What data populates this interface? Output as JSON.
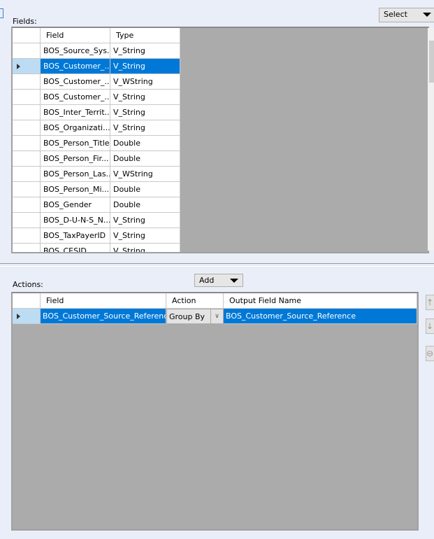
{
  "fields_label": "Fields:",
  "select_label": "Select",
  "fields_grid": {
    "headers": [
      "Field",
      "Type"
    ],
    "rows": [
      {
        "field": "BOS_Source_Sys...",
        "type": "V_String"
      },
      {
        "field": "BOS_Customer_...",
        "type": "V_String",
        "selected": true
      },
      {
        "field": "BOS_Customer_...",
        "type": "V_WString"
      },
      {
        "field": "BOS_Customer_...",
        "type": "V_String"
      },
      {
        "field": "BOS_Inter_Territ...",
        "type": "V_String"
      },
      {
        "field": "BOS_Organizati...",
        "type": "V_String"
      },
      {
        "field": "BOS_Person_Title",
        "type": "Double"
      },
      {
        "field": "BOS_Person_Fir...",
        "type": "Double"
      },
      {
        "field": "BOS_Person_Las...",
        "type": "V_WString"
      },
      {
        "field": "BOS_Person_Mi...",
        "type": "Double"
      },
      {
        "field": "BOS_Gender",
        "type": "Double"
      },
      {
        "field": "BOS_D-U-N-S_N...",
        "type": "V_String"
      },
      {
        "field": "BOS_TaxPayerID",
        "type": "V_String"
      },
      {
        "field": "BOS_CESID",
        "type": "V_String"
      }
    ]
  },
  "actions_label": "Actions:",
  "add_label": "Add",
  "actions_grid": {
    "headers": [
      "Field",
      "Action",
      "Output Field Name"
    ],
    "rows": [
      {
        "field": "BOS_Customer_Source_Reference",
        "action": "Group By",
        "output": "BOS_Customer_Source_Reference"
      }
    ]
  }
}
